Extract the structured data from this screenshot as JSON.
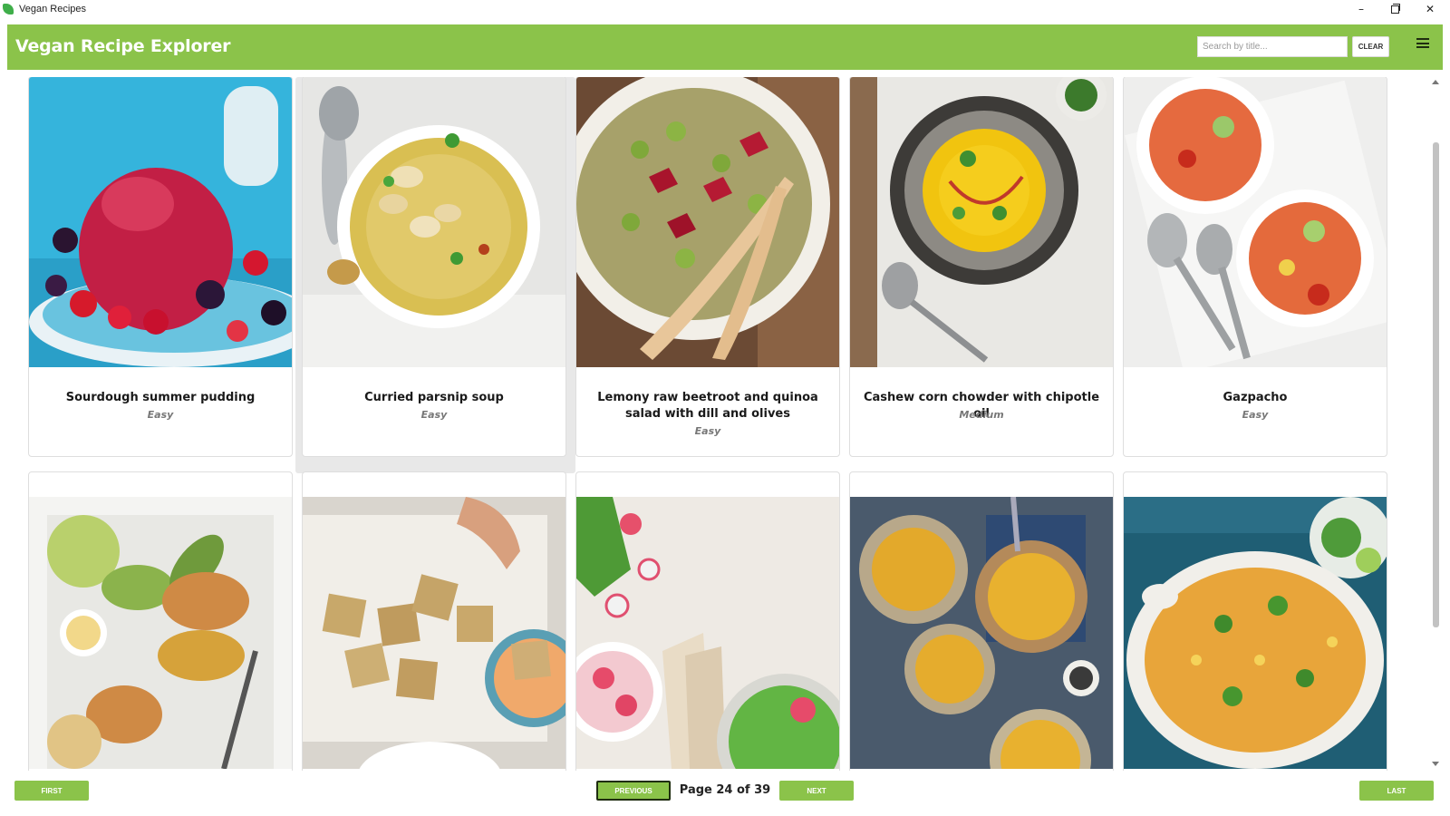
{
  "window": {
    "title": "Vegan Recipes",
    "controls": {
      "minimize": "–",
      "close": "✕"
    }
  },
  "header": {
    "title": "Vegan Recipe Explorer",
    "search_placeholder": "Search by title...",
    "search_value": "",
    "clear_label": "CLEAR",
    "menu_icon": "hamburger-menu-icon"
  },
  "colors": {
    "accent": "#8bc34a",
    "accent_dark": "#1f2d10",
    "text": "#1a1a1a",
    "muted": "#777777"
  },
  "recipes": [
    {
      "title": "Sourdough summer pudding",
      "difficulty": "Easy",
      "image": "berry-pudding-photo"
    },
    {
      "title": "Curried parsnip soup",
      "difficulty": "Easy",
      "image": "parsnip-soup-photo"
    },
    {
      "title": "Lemony raw beetroot and quinoa salad with dill and olives",
      "difficulty": "Easy",
      "image": "beetroot-quinoa-salad-photo"
    },
    {
      "title": "Cashew corn chowder with chipotle oil",
      "difficulty": "Medium",
      "image": "corn-chowder-photo"
    },
    {
      "title": "Gazpacho",
      "difficulty": "Easy",
      "image": "gazpacho-photo"
    },
    {
      "title": "",
      "difficulty": "",
      "image": "veggie-burger-photo"
    },
    {
      "title": "",
      "difficulty": "",
      "image": "tofu-skewers-photo"
    },
    {
      "title": "",
      "difficulty": "",
      "image": "radish-pea-dip-photo"
    },
    {
      "title": "",
      "difficulty": "",
      "image": "mac-cheese-bowls-photo"
    },
    {
      "title": "",
      "difficulty": "",
      "image": "curry-pot-photo"
    }
  ],
  "pagination": {
    "first_label": "FIRST",
    "previous_label": "PREVIOUS",
    "page_text": "Page 24 of 39",
    "current_page": 24,
    "total_pages": 39,
    "next_label": "NEXT",
    "last_label": "LAST"
  }
}
